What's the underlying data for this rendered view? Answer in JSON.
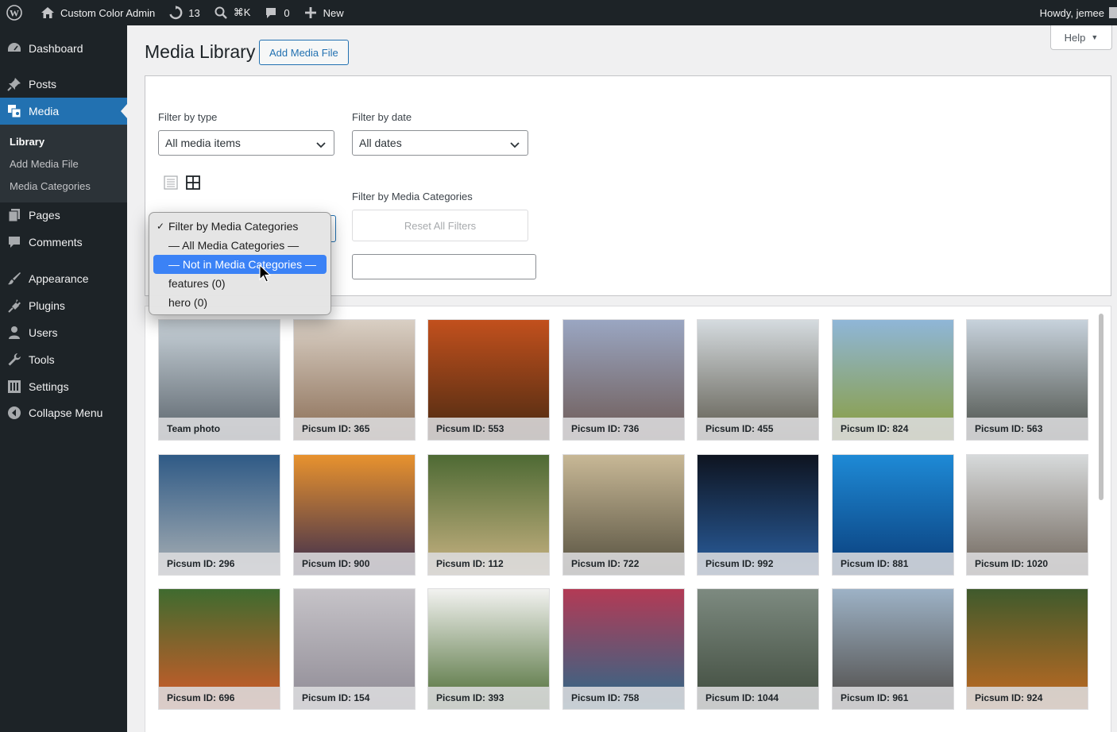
{
  "adminbar": {
    "site_name": "Custom Color Admin",
    "updates_count": "13",
    "search_shortcut": "⌘K",
    "comments_count": "0",
    "new_label": "New",
    "howdy": "Howdy, jemee"
  },
  "sidebar": {
    "items": [
      {
        "label": "Dashboard",
        "icon": "dashboard-icon"
      },
      {
        "label": "Posts",
        "icon": "pin-icon"
      },
      {
        "label": "Media",
        "icon": "media-icon"
      },
      {
        "label": "Pages",
        "icon": "pages-icon"
      },
      {
        "label": "Comments",
        "icon": "comment-icon"
      },
      {
        "label": "Appearance",
        "icon": "brush-icon"
      },
      {
        "label": "Plugins",
        "icon": "plug-icon"
      },
      {
        "label": "Users",
        "icon": "user-icon"
      },
      {
        "label": "Tools",
        "icon": "wrench-icon"
      },
      {
        "label": "Settings",
        "icon": "settings-icon"
      },
      {
        "label": "Collapse Menu",
        "icon": "collapse-icon"
      }
    ],
    "submenu": [
      "Library",
      "Add Media File",
      "Media Categories"
    ]
  },
  "page": {
    "title": "Media Library",
    "add_button": "Add Media File",
    "help": "Help"
  },
  "filters": {
    "type_label": "Filter by type",
    "type_value": "All media items",
    "date_label": "Filter by date",
    "date_value": "All dates",
    "category_label": "Filter by Media Categories",
    "reset_label": "Reset All Filters"
  },
  "dropdown": {
    "options": [
      "Filter by Media Categories",
      "— All Media Categories —",
      "— Not in Media Categories —",
      "features  (0)",
      "hero  (0)"
    ],
    "checked_index": 0,
    "highlighted_index": 2
  },
  "media": [
    {
      "caption": "Team photo",
      "colors": [
        "#c9d3da",
        "#5a636b"
      ]
    },
    {
      "caption": "Picsum ID: 365",
      "colors": [
        "#d9cfc4",
        "#8a6d55"
      ]
    },
    {
      "caption": "Picsum ID: 553",
      "colors": [
        "#c2501d",
        "#4a2a12"
      ]
    },
    {
      "caption": "Picsum ID: 736",
      "colors": [
        "#9aa6c2",
        "#6e5a55"
      ]
    },
    {
      "caption": "Picsum ID: 455",
      "colors": [
        "#d5dbdf",
        "#5d5a4e"
      ]
    },
    {
      "caption": "Picsum ID: 824",
      "colors": [
        "#8fb6d8",
        "#8a9d3c"
      ]
    },
    {
      "caption": "Picsum ID: 563",
      "colors": [
        "#c7d2dc",
        "#4b4f48"
      ]
    },
    {
      "caption": "Picsum ID: 296",
      "colors": [
        "#2f5a86",
        "#a9b0b4"
      ]
    },
    {
      "caption": "Picsum ID: 900",
      "colors": [
        "#e8922e",
        "#3a2c4e"
      ]
    },
    {
      "caption": "Picsum ID: 112",
      "colors": [
        "#4e6a34",
        "#c9b383"
      ]
    },
    {
      "caption": "Picsum ID: 722",
      "colors": [
        "#c8b896",
        "#55503f"
      ]
    },
    {
      "caption": "Picsum ID: 992",
      "colors": [
        "#0e1420",
        "#2a5fa0"
      ]
    },
    {
      "caption": "Picsum ID: 881",
      "colors": [
        "#1e8ad6",
        "#0a3d7a"
      ]
    },
    {
      "caption": "Picsum ID: 1020",
      "colors": [
        "#d7dadb",
        "#6f655b"
      ]
    },
    {
      "caption": "Picsum ID: 696",
      "colors": [
        "#3f6b2f",
        "#d45a28"
      ]
    },
    {
      "caption": "Picsum ID: 154",
      "colors": [
        "#c6c3c8",
        "#8e8a94"
      ]
    },
    {
      "caption": "Picsum ID: 393",
      "colors": [
        "#f2f2f0",
        "#4b6b33"
      ]
    },
    {
      "caption": "Picsum ID: 758",
      "colors": [
        "#b33a55",
        "#2b6a8a"
      ]
    },
    {
      "caption": "Picsum ID: 1044",
      "colors": [
        "#7d8a80",
        "#3e4a3c"
      ]
    },
    {
      "caption": "Picsum ID: 961",
      "colors": [
        "#9db2c6",
        "#4e4a46"
      ]
    },
    {
      "caption": "Picsum ID: 924",
      "colors": [
        "#3f5a2c",
        "#c46a22"
      ]
    }
  ]
}
